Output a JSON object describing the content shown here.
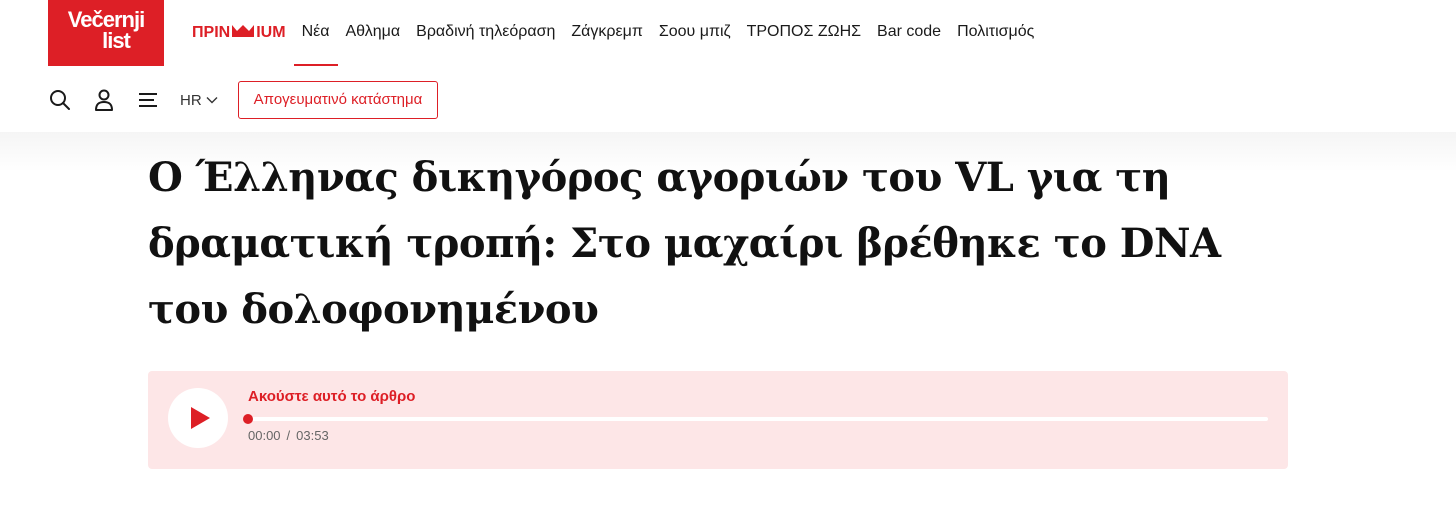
{
  "brand": {
    "logo_line1": "Večernji",
    "logo_line2": "list",
    "accent_color": "#dd1f26"
  },
  "nav": {
    "premium": {
      "before": "ΠΡΙΝ",
      "after": "IUM",
      "icon": "crown-icon"
    },
    "items": [
      {
        "label": "Νέα",
        "active": true
      },
      {
        "label": "Αθλημα"
      },
      {
        "label": "Βραδινή τηλεόραση"
      },
      {
        "label": "Ζάγκρεμπ"
      },
      {
        "label": "Σοου μπιζ"
      },
      {
        "label": "ΤΡΟΠΟΣ ΖΩΗΣ"
      },
      {
        "label": "Bar code"
      },
      {
        "label": "Πολιτισμός"
      }
    ]
  },
  "toolbar": {
    "icons": [
      "search-icon",
      "user-icon",
      "menu-icon"
    ],
    "language": "HR",
    "store_button": "Απογευματινό κατάστημα"
  },
  "article": {
    "title": "Ο Έλληνας δικηγόρος αγοριών του VL για τη δραματική τροπή: Στο μαχαίρι βρέθηκε το DNA του δολοφονημένου"
  },
  "audio_player": {
    "label": "Ακούστε αυτό το άρθρο",
    "current_time": "00:00",
    "separator": "/",
    "duration": "03:53",
    "progress": 0
  }
}
